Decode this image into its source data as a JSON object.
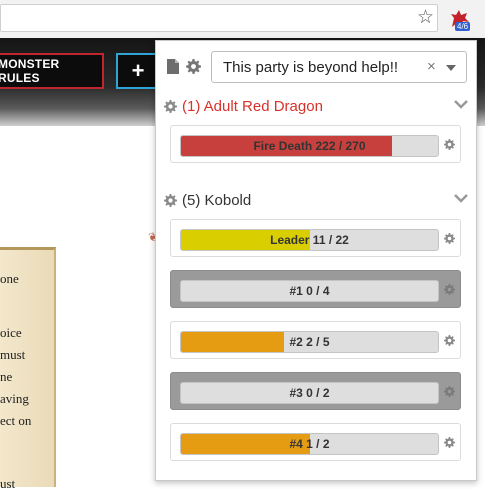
{
  "browser": {
    "badge_text": "4/6"
  },
  "page": {
    "monster_rules_label": "MONSTER RULES",
    "plus_label": "+",
    "scroll_lines": [
      "one",
      "oice",
      "must",
      "ne",
      "aving",
      "ect on",
      "ust"
    ]
  },
  "popup": {
    "party_name": "This party is beyond help!!",
    "clear_symbol": "×",
    "groups": [
      {
        "title": "(1) Adult Red Dragon",
        "title_color": "#d9312b",
        "members": [
          {
            "text": "Fire Death 222 / 270",
            "hp_fraction": 0.822,
            "color": "#c8403d",
            "dead": false
          }
        ]
      },
      {
        "title": "(5) Kobold",
        "title_color": "#333333",
        "members": [
          {
            "text": "Leader 11 / 22",
            "hp_fraction": 0.5,
            "color": "#d9cf00",
            "dead": false
          },
          {
            "text": "#1 0 / 4",
            "hp_fraction": 0.0,
            "color": "#e59b12",
            "dead": true
          },
          {
            "text": "#2 2 / 5",
            "hp_fraction": 0.4,
            "color": "#e59b12",
            "dead": false
          },
          {
            "text": "#3 0 / 2",
            "hp_fraction": 0.0,
            "color": "#e59b12",
            "dead": true
          },
          {
            "text": "#4 1 / 2",
            "hp_fraction": 0.5,
            "color": "#e59b12",
            "dead": false
          }
        ]
      }
    ]
  }
}
